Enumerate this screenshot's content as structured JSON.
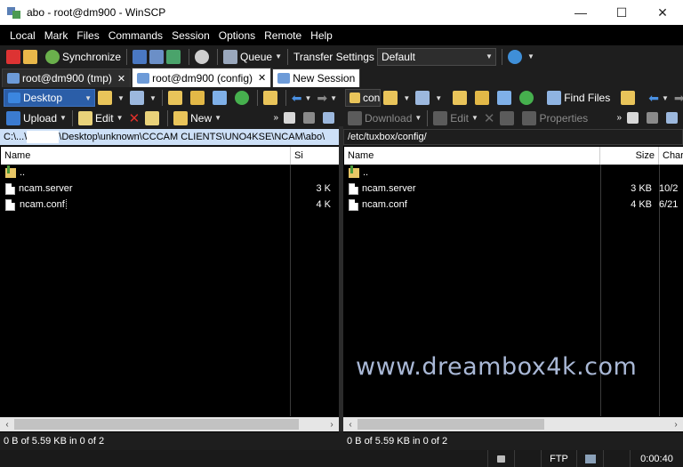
{
  "window": {
    "title": "abo - root@dm900 - WinSCP",
    "controls": {
      "minimize": "—",
      "maximize": "☐",
      "close": "✕"
    }
  },
  "menu": [
    "Local",
    "Mark",
    "Files",
    "Commands",
    "Session",
    "Options",
    "Remote",
    "Help"
  ],
  "toolbar": {
    "synchronize": "Synchronize",
    "queue": "Queue",
    "transfer_settings_label": "Transfer Settings",
    "transfer_settings_value": "Default"
  },
  "tabs": [
    {
      "label": "root@dm900 (tmp)",
      "close": "✕"
    },
    {
      "label": "root@dm900 (config)",
      "close": "✕"
    },
    {
      "label": "New Session"
    }
  ],
  "left_panel": {
    "location": "Desktop",
    "upload": "Upload",
    "edit": "Edit",
    "new": "New",
    "path_start": "C:\\...\\",
    "path_rest": "\\Desktop\\unknown\\CCCAM CLIENTS\\UNO4KSE\\NCAM\\abo\\",
    "columns": [
      "Name",
      "Si"
    ],
    "files": [
      {
        "name": "..",
        "size": ""
      },
      {
        "name": "ncam.server",
        "size": "3 K"
      },
      {
        "name": "ncam.conf",
        "size": "4 K"
      }
    ],
    "status": "0 B of 5.59 KB in 0 of 2"
  },
  "right_panel": {
    "location": "con",
    "find_files": "Find Files",
    "download": "Download",
    "edit": "Edit",
    "properties": "Properties",
    "path": "/etc/tuxbox/config/",
    "columns": [
      "Name",
      "Size",
      "Char"
    ],
    "files": [
      {
        "name": "..",
        "size": "",
        "changed": ""
      },
      {
        "name": "ncam.server",
        "size": "3 KB",
        "changed": "10/2"
      },
      {
        "name": "ncam.conf",
        "size": "4 KB",
        "changed": "6/21"
      }
    ],
    "status": "0 B of 5.59 KB in 0 of 2"
  },
  "statusbar": {
    "protocol": "FTP",
    "time": "0:00:40"
  },
  "watermark": "www.dreambox4k.com",
  "colors": {
    "accent": "#2b74d0",
    "path_active_bg": "#cde0f7",
    "watermark": "#a9b8d6"
  }
}
